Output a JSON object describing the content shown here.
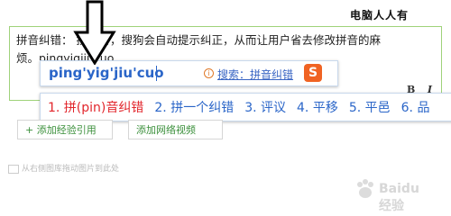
{
  "brand": "电脑人人有",
  "editor": {
    "text_line1": "拼音纠错：                拼音时，搜狗会自动提示纠正，从而让用户省去修改拼音的麻",
    "text_line2": "烦。pingyigjiucuo",
    "toolbar": [
      "B",
      "I"
    ]
  },
  "ime": {
    "pinyin": "ping'yig'jiu'cuo",
    "search_label": "搜索：拼音纠错",
    "logo_text": "S",
    "candidates": [
      {
        "index": "1.",
        "text": "拼(pin)音纠错",
        "selected": true
      },
      {
        "index": "2.",
        "text": "拼一个纠错",
        "selected": false
      },
      {
        "index": "3.",
        "text": "评议",
        "selected": false
      },
      {
        "index": "4.",
        "text": "平移",
        "selected": false
      },
      {
        "index": "5.",
        "text": "平邑",
        "selected": false
      },
      {
        "index": "6.",
        "text": "品",
        "selected": false
      }
    ]
  },
  "buttons": {
    "add_reference": "+ 添加经验引用",
    "add_video": "添加网络视频"
  },
  "hint": "从右侧图库拖动图片到此处",
  "watermark": "Baidu 经验",
  "colors": {
    "candidate_blue": "#2a65c8",
    "candidate_selected": "#e2262c",
    "editor_border": "#9fd27a",
    "sogou_orange": "#f06323"
  }
}
